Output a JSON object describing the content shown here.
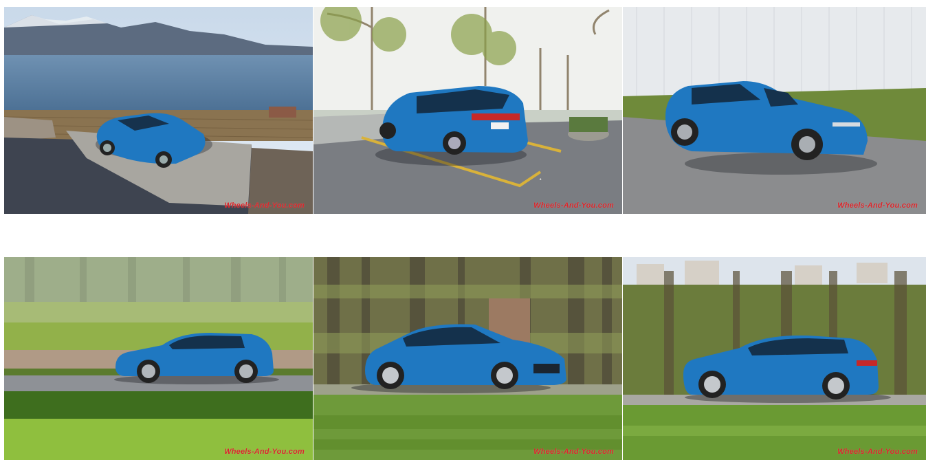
{
  "gallery": {
    "car_color": "#1f78c1",
    "photos": [
      {
        "scene": "car-on-terrace-lake-mountains",
        "watermark": "Wheels-And-You.com"
      },
      {
        "scene": "car-rear-parking-hotel",
        "watermark": "Wheels-And-You.com"
      },
      {
        "scene": "car-front-wall-grass",
        "watermark": "Wheels-And-You.com"
      },
      {
        "scene": "car-side-pan-field",
        "watermark": "Wheels-And-You.com"
      },
      {
        "scene": "car-side-pan-forest",
        "watermark": "Wheels-And-You.com"
      },
      {
        "scene": "car-side-pan-village",
        "watermark": "Wheels-And-You.com"
      }
    ]
  }
}
